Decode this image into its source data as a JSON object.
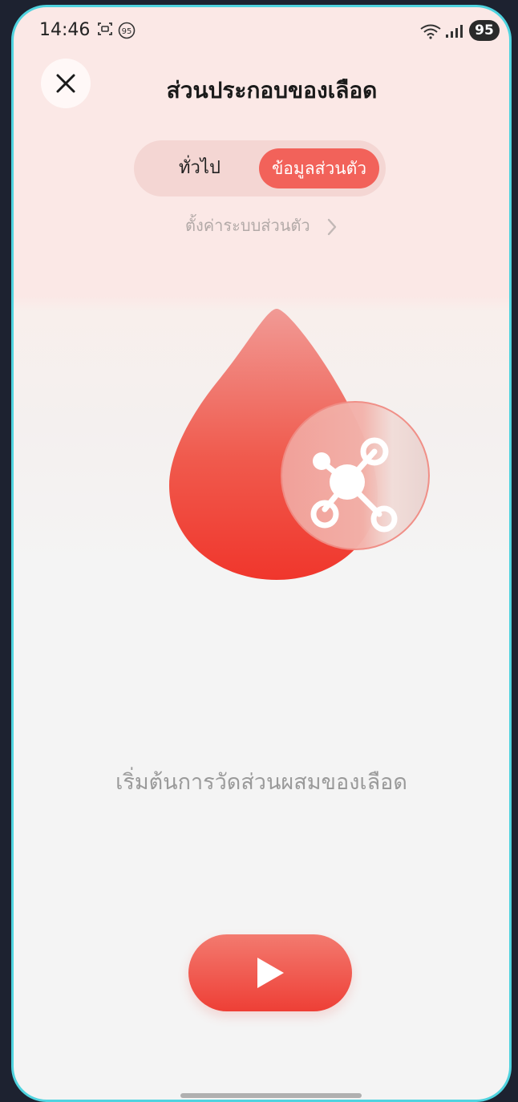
{
  "status_bar": {
    "time": "14:46",
    "notification_badge": "95",
    "battery": "95"
  },
  "header": {
    "title": "ส่วนประกอบของเลือด",
    "close_icon": "close-icon"
  },
  "tabs": {
    "general_label": "ทั่วไป",
    "personal_label": "ข้อมูลส่วนตัว",
    "selected": "personal"
  },
  "settings_link": {
    "label": "ตั้งค่าระบบส่วนตัว"
  },
  "hero": {
    "icon": "blood-drop-molecule-icon"
  },
  "prompt_text": "เริ่มต้นการวัดส่วนผสมของเลือด",
  "start_button": {
    "icon": "play-icon"
  },
  "colors": {
    "accent": "#f2625a",
    "drop_top": "#f19a95",
    "drop_bottom": "#f0362c"
  }
}
